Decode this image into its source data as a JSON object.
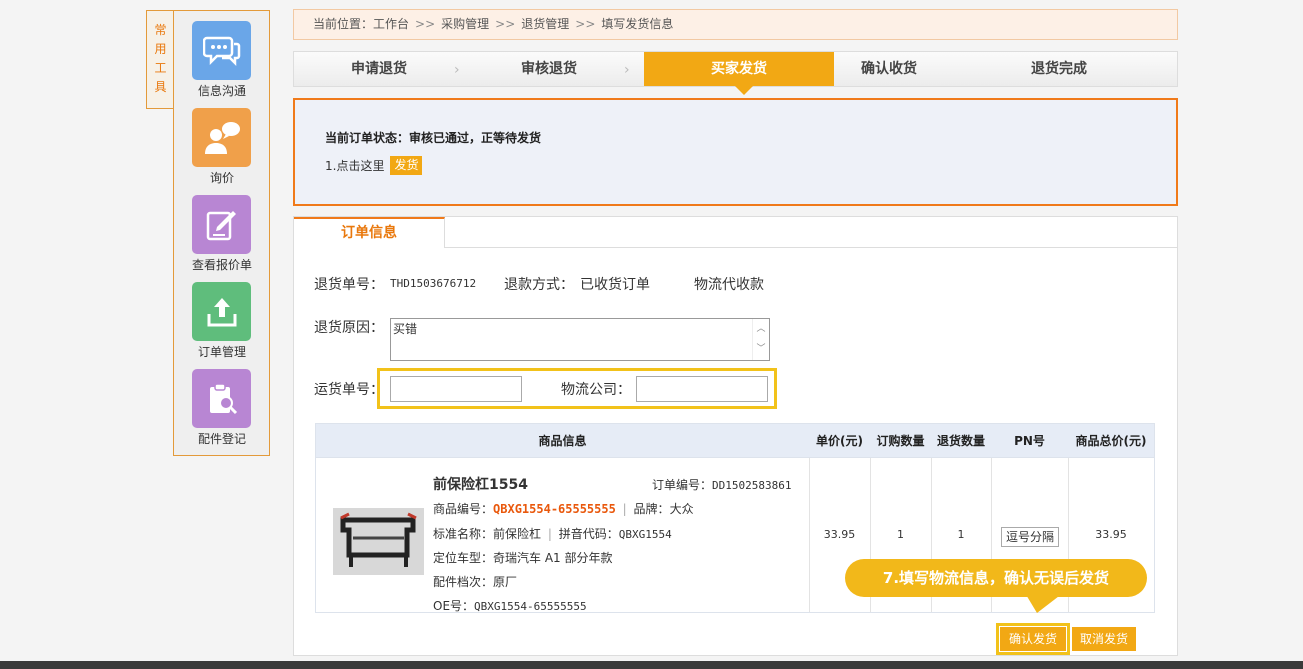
{
  "sidebar": {
    "tab_label": "常用工具",
    "tools": [
      {
        "label": "信息沟通",
        "color": "#6aa6e8",
        "icon": "chat-icon"
      },
      {
        "label": "询价",
        "color": "#f0a04a",
        "icon": "user-chat-icon"
      },
      {
        "label": "查看报价单",
        "color": "#b886d3",
        "icon": "edit-doc-icon"
      },
      {
        "label": "订单管理",
        "color": "#5fbd7c",
        "icon": "upload-icon"
      },
      {
        "label": "配件登记",
        "color": "#b886d3",
        "icon": "clipboard-search-icon"
      }
    ]
  },
  "breadcrumb": {
    "prefix": "当前位置：",
    "items": [
      "工作台",
      "采购管理",
      "退货管理",
      "填写发货信息"
    ],
    "separator": ">>"
  },
  "steps": [
    "申请退货",
    "审核退货",
    "买家发货",
    "确认收货",
    "退货完成"
  ],
  "active_step": 2,
  "status": {
    "title": "当前订单状态：审核已通过，正等待发货",
    "hint": "1.点击这里",
    "ship_button": "发货"
  },
  "order": {
    "tab_label": "订单信息",
    "return_no_label": "退货单号：",
    "return_no": "THD1503676712",
    "refund_method_label": "退款方式：",
    "refund_method": "已收货订单",
    "refund_extra": "物流代收款",
    "reason_label": "退货原因：",
    "reason_value": "买错",
    "shipping_no_label": "运货单号：",
    "shipping_no_value": "",
    "logistics_label": "物流公司：",
    "logistics_value": ""
  },
  "table": {
    "headers": [
      "商品信息",
      "单价(元)",
      "订购数量",
      "退货数量",
      "PN号",
      "商品总价(元)"
    ],
    "row": {
      "name": "前保险杠1554",
      "order_no_label": "订单编号：",
      "order_no": "DD1502583861",
      "code_label": "商品编号：",
      "code": "QBXG1554-65555555",
      "brand_label": "品牌：",
      "brand": "大众",
      "std_name_label": "标准名称：",
      "std_name": "前保险杠",
      "pinyin_label": "拼音代码：",
      "pinyin": "QBXG1554",
      "model_label": "定位车型：",
      "model": "奇瑞汽车 A1 部分年款",
      "grade_label": "配件档次：",
      "grade": "原厂",
      "oe_label": "OE号：",
      "oe": "QBXG1554-65555555",
      "unit_price": "33.95",
      "order_qty": "1",
      "return_qty": "1",
      "pn_placeholder": "逗号分隔",
      "total": "33.95"
    }
  },
  "callout": "7.填写物流信息，确认无误后发货",
  "buttons": {
    "confirm": "确认发货",
    "cancel": "取消发货"
  }
}
